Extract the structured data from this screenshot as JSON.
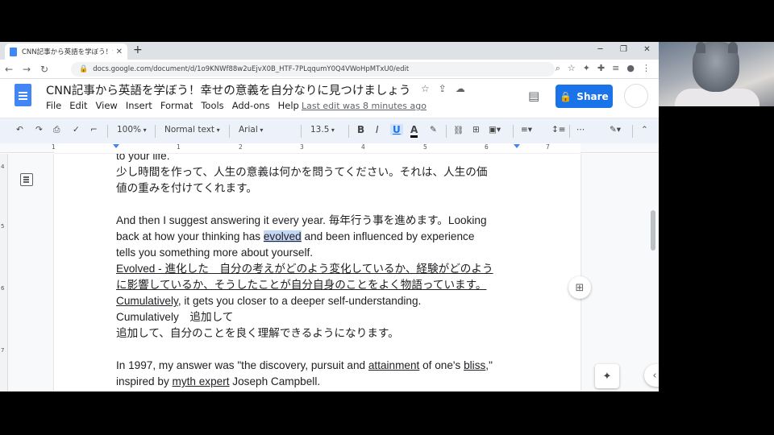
{
  "browser": {
    "tab_title": "CNN記事から英語を学ぼう！幸せの",
    "url": "docs.google.com/document/d/1o9KNWf88w2uEjvX0B_HTF-7PLqqumY0Q4VWoHpMTxU0/edit"
  },
  "docs": {
    "title": "CNN記事から英語を学ぼう！幸せの意義を自分なりに見つけましょう",
    "menus": [
      "File",
      "Edit",
      "View",
      "Insert",
      "Format",
      "Tools",
      "Add-ons",
      "Help"
    ],
    "last_edit": "Last edit was 8 minutes ago",
    "share_label": "Share"
  },
  "toolbar": {
    "zoom": "100%",
    "style": "Normal text",
    "font": "Arial",
    "size": "13.5",
    "bold": "B",
    "italic": "I",
    "underline": "U",
    "text_color": "A"
  },
  "ruler": {
    "numbers": [
      "1",
      "1",
      "2",
      "3",
      "4",
      "5",
      "6",
      "7"
    ]
  },
  "vruler": {
    "numbers": [
      "4",
      "5",
      "6",
      "7"
    ]
  },
  "document": {
    "l1": "to your life.",
    "l2": "少し時間を作って、人生の意義は何かを問うてください。それは、人生の価",
    "l3": "値の重みを付けてくれます。",
    "l5a": "And then I suggest answering it every year. 毎年行う事を進めます。Looking",
    "l6a": "back at how your thinking has ",
    "l6b": "evolved",
    "l6c": " and been influenced by experience",
    "l7": "tells you something more about yourself.",
    "l8": "Evolved - 進化した　自分の考えがどのよう変化しているか、経験がどのよう",
    "l9": "に影響しているか、そうしたことが自分自身のことをよく物語っています。",
    "l10a": "Cumulatively",
    "l10b": ", it gets you closer to a deeper self-understanding.",
    "l11": "Cumulatively　追加して",
    "l12": "追加して、自分のことを良く理解できるようになります。",
    "l14a": "In 1997, my answer was \"the discovery, pursuit and ",
    "l14b": "attainment",
    "l14c": " of one's ",
    "l14d": "bliss",
    "l14e": ",\"",
    "l15a": "inspired by ",
    "l15b": "myth expert",
    "l15c": " Joseph Campbell."
  },
  "colors": {
    "share_blue": "#1a73e8",
    "toolbar_bg": "#edf2fa",
    "selection": "#c5d7f7"
  }
}
